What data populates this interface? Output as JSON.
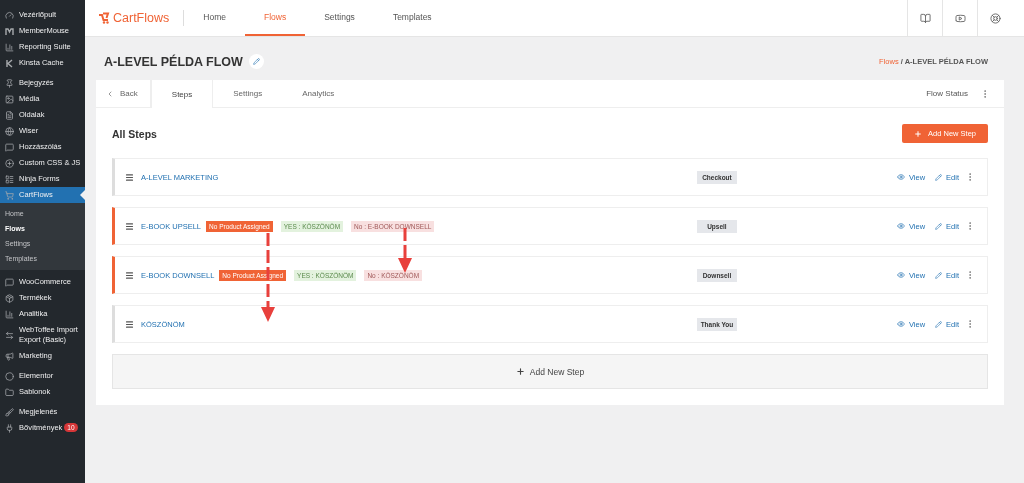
{
  "sidebar": {
    "items": [
      {
        "label": "Vezérlőpult",
        "selected": false
      },
      {
        "label": "MemberMouse",
        "selected": false
      },
      {
        "label": "Reporting Suite",
        "selected": false
      },
      {
        "label": "Kinsta Cache",
        "selected": false
      },
      {
        "label": "Bejegyzés",
        "selected": false
      },
      {
        "label": "Média",
        "selected": false
      },
      {
        "label": "Oldalak",
        "selected": false
      },
      {
        "label": "Wiser",
        "selected": false
      },
      {
        "label": "Hozzászólás",
        "selected": false
      },
      {
        "label": "Custom CSS & JS",
        "selected": false
      },
      {
        "label": "Ninja Forms",
        "selected": false
      },
      {
        "label": "CartFlows",
        "selected": true,
        "children": [
          {
            "label": "Home",
            "selected": false
          },
          {
            "label": "Flows",
            "selected": true
          },
          {
            "label": "Settings",
            "selected": false
          },
          {
            "label": "Templates",
            "selected": false
          }
        ]
      },
      {
        "label": "WooCommerce",
        "selected": false
      },
      {
        "label": "Termékek",
        "selected": false
      },
      {
        "label": "Analitika",
        "selected": false
      },
      {
        "label": "WebToffee Import Export (Basic)",
        "selected": false
      },
      {
        "label": "Marketing",
        "selected": false
      },
      {
        "label": "Elementor",
        "selected": false
      },
      {
        "label": "Sablonok",
        "selected": false
      },
      {
        "label": "Megjelenés",
        "selected": false
      },
      {
        "label": "Bővítmények",
        "selected": false,
        "badge": "10"
      }
    ]
  },
  "topbar": {
    "logo": "CartFlows",
    "nav": [
      {
        "label": "Home",
        "selected": false
      },
      {
        "label": "Flows",
        "selected": true
      },
      {
        "label": "Settings",
        "selected": false
      },
      {
        "label": "Templates",
        "selected": false
      }
    ]
  },
  "page_title": "A-LEVEL PÉLDA FLOW",
  "breadcrumb": {
    "link": "Flows",
    "separator": "/",
    "current": "A-LEVEL PÉLDA FLOW"
  },
  "tabs": [
    {
      "label": "Back",
      "kind": "back",
      "selected": false
    },
    {
      "label": "Steps",
      "kind": "tab",
      "selected": true
    },
    {
      "label": "Settings",
      "kind": "tab",
      "selected": false
    },
    {
      "label": "Analytics",
      "kind": "tab",
      "selected": false
    }
  ],
  "flow_status": "Flow Status",
  "section_title": "All Steps",
  "add_button": "Add New Step",
  "steps": [
    {
      "name": "A-LEVEL MARKETING",
      "flagged": false,
      "type": "Checkout",
      "view": "View",
      "edit": "Edit"
    },
    {
      "name": "E-BOOK UPSELL",
      "flagged": true,
      "badges": [
        {
          "kind": "warning",
          "text": "No Product Assigned"
        },
        {
          "kind": "yes",
          "text": "YES : KÖSZÖNÖM"
        },
        {
          "kind": "no",
          "text": "No : E-BOOK DOWNSELL"
        }
      ],
      "type": "Upsell",
      "view": "View",
      "edit": "Edit"
    },
    {
      "name": "E-BOOK DOWNSELL",
      "flagged": true,
      "badges": [
        {
          "kind": "warning",
          "text": "No Product Assigned"
        },
        {
          "kind": "yes",
          "text": "YES : KÖSZÖNÖM"
        },
        {
          "kind": "no",
          "text": "No : KÖSZÖNÖM"
        }
      ],
      "type": "Downsell",
      "view": "View",
      "edit": "Edit"
    },
    {
      "name": "KÖSZÖNÖM",
      "flagged": false,
      "type": "Thank You",
      "view": "View",
      "edit": "Edit"
    }
  ],
  "add_step_row": "Add New Step"
}
